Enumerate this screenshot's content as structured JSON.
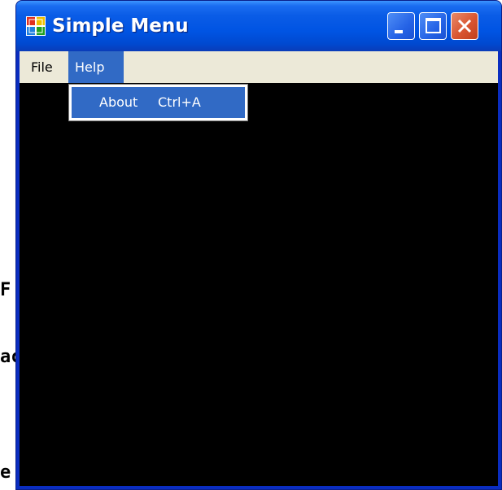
{
  "background_fragments": [
    "F",
    "ac",
    "e"
  ],
  "window": {
    "title": "Simple Menu",
    "app_icon": "windows-form-icon",
    "buttons": {
      "minimize": "minimize-icon",
      "maximize": "maximize-icon",
      "close": "close-icon"
    }
  },
  "menubar": {
    "items": [
      {
        "label": "File"
      },
      {
        "label": "Help"
      }
    ]
  },
  "dropdown": {
    "items": [
      {
        "label": "About",
        "shortcut": "Ctrl+A"
      }
    ]
  },
  "colors": {
    "titlebar": "#0054e3",
    "menu_highlight": "#316ac5",
    "menubar": "#ece9d8",
    "client": "#000000",
    "close_button": "#d95530"
  }
}
